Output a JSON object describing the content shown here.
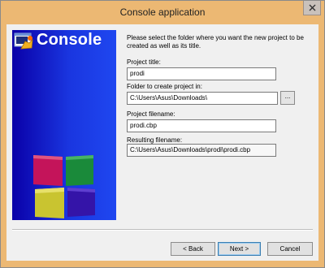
{
  "window": {
    "title": "Console application"
  },
  "side_panel": {
    "brand_text": "Console"
  },
  "instruction": "Please select the folder where you want the new project to be created as well as its title.",
  "fields": {
    "project_title": {
      "label": "Project title:",
      "value": "prodi"
    },
    "folder": {
      "label": "Folder to create project in:",
      "value": "C:\\Users\\Asus\\Downloads\\"
    },
    "project_filename": {
      "label": "Project filename:",
      "value": "prodi.cbp"
    },
    "resulting_filename": {
      "label": "Resulting filename:",
      "value": "C:\\Users\\Asus\\Downloads\\prodi\\prodi.cbp"
    }
  },
  "browse_label": "...",
  "buttons": {
    "back": "< Back",
    "next": "Next >",
    "cancel": "Cancel"
  },
  "icons": {
    "close": "close-icon",
    "logo": "console-app-icon",
    "blocks": "colored-blocks-art"
  },
  "colors": {
    "titlebar": "#ecb873",
    "panel_dark": "#0a00a8",
    "panel_light": "#1f47f0",
    "close_hover": "#c9c1bb"
  }
}
